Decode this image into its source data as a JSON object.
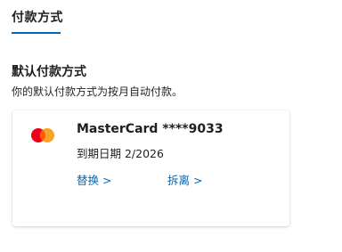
{
  "tab": {
    "label": "付款方式"
  },
  "section": {
    "title": "默认付款方式",
    "description": "你的默认付款方式为按月自动付款。"
  },
  "card": {
    "brand_icon": "mastercard-logo",
    "name": "MasterCard ****9033",
    "expiry": "到期日期 2/2026",
    "replace_label": "替换 >",
    "remove_label": "拆离 >"
  },
  "colors": {
    "accent": "#0067b8",
    "mc_red": "#eb001b",
    "mc_orange": "#f79e1b"
  }
}
